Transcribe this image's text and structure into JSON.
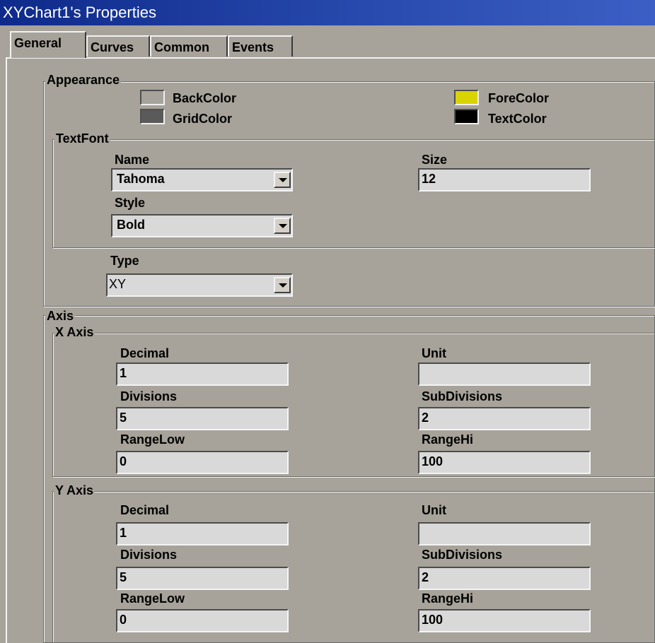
{
  "window": {
    "title": "XYChart1's Properties"
  },
  "tabs": [
    {
      "label": "General",
      "active": true
    },
    {
      "label": "Curves",
      "active": false
    },
    {
      "label": "Common",
      "active": false
    },
    {
      "label": "Events",
      "active": false
    }
  ],
  "appearance": {
    "legend": "Appearance",
    "back_color": {
      "label": "BackColor",
      "color": "#a7a39a"
    },
    "grid_color": {
      "label": "GridColor",
      "color": "#5a5a5a"
    },
    "fore_color": {
      "label": "ForeColor",
      "color": "#d9d400"
    },
    "text_color": {
      "label": "TextColor",
      "color": "#000000"
    },
    "text_font": {
      "legend": "TextFont",
      "name_label": "Name",
      "name_value": "Tahoma",
      "size_label": "Size",
      "size_value": "12",
      "style_label": "Style",
      "style_value": "Bold"
    },
    "type_label": "Type",
    "type_value": "XY"
  },
  "axis": {
    "legend": "Axis",
    "x_axis": {
      "legend": "X Axis",
      "decimal_label": "Decimal",
      "decimal_value": "1",
      "unit_label": "Unit",
      "unit_value": "",
      "divisions_label": "Divisions",
      "divisions_value": "5",
      "subdivisions_label": "SubDivisions",
      "subdivisions_value": "2",
      "range_low_label": "RangeLow",
      "range_low_value": "0",
      "range_hi_label": "RangeHi",
      "range_hi_value": "100"
    },
    "y_axis": {
      "legend": "Y Axis",
      "decimal_label": "Decimal",
      "decimal_value": "1",
      "unit_label": "Unit",
      "unit_value": "",
      "divisions_label": "Divisions",
      "divisions_value": "5",
      "subdivisions_label": "SubDivisions",
      "subdivisions_value": "2",
      "range_low_label": "RangeLow",
      "range_low_value": "0",
      "range_hi_label": "RangeHi",
      "range_hi_value": "100"
    }
  }
}
